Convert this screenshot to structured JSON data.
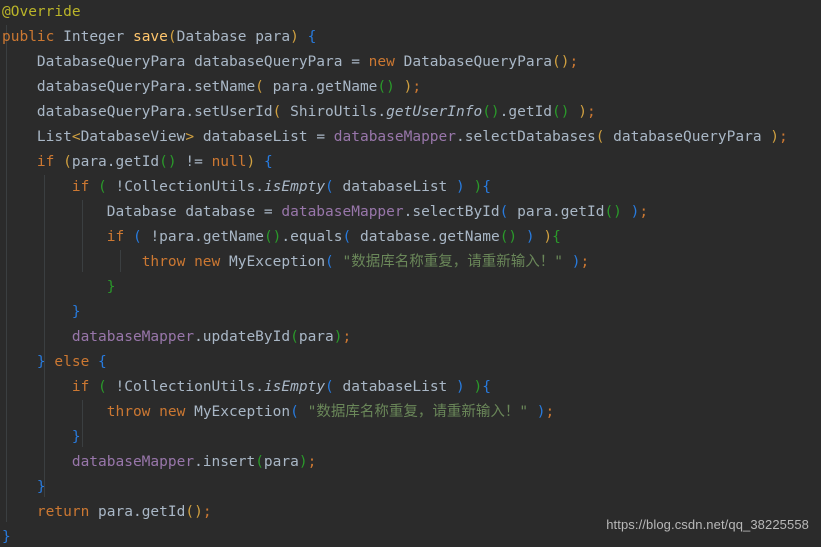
{
  "editor": {
    "background_color": "#2b2b2b",
    "default_text_color": "#a9b7c6",
    "language": "Java",
    "theme": "Darcula"
  },
  "colors": {
    "keyword": "#cc7832",
    "annotation": "#bbb529",
    "method_declaration": "#ffc66d",
    "field": "#9876aa",
    "string": "#6a8759",
    "identifier": "#a9b7c6",
    "paren_level1": "#d0a040",
    "paren_level2": "#287bde",
    "paren_level3": "#2a9a2a",
    "indent_guide": "#3b3f41"
  },
  "code": {
    "lines": [
      "@Override",
      "public Integer save(Database para) {",
      "    DatabaseQueryPara databaseQueryPara = new DatabaseQueryPara();",
      "    databaseQueryPara.setName( para.getName() );",
      "    databaseQueryPara.setUserId( ShiroUtils.getUserInfo().getId() );",
      "    List<DatabaseView> databaseList = databaseMapper.selectDatabases( databaseQueryPara );",
      "    if (para.getId() != null) {",
      "        if ( !CollectionUtils.isEmpty( databaseList ) ){",
      "            Database database = databaseMapper.selectById( para.getId() );",
      "            if ( !para.getName().equals( database.getName() ) ){",
      "                throw new MyException( \"数据库名称重复，请重新输入！\" );",
      "            }",
      "        }",
      "        databaseMapper.updateById(para);",
      "    } else {",
      "        if ( !CollectionUtils.isEmpty( databaseList ) ){",
      "            throw new MyException( \"数据库名称重复，请重新输入！\" );",
      "        }",
      "        databaseMapper.insert(para);",
      "    }",
      "    return para.getId();",
      "}"
    ],
    "strings": {
      "duplicate_name_message": "数据库名称重复，请重新输入！"
    },
    "identifiers": {
      "annotation": "@Override",
      "method_name": "save",
      "return_type": "Integer",
      "parameter_type": "Database",
      "parameter_name": "para",
      "query_para_type": "DatabaseQueryPara",
      "query_para_var": "databaseQueryPara",
      "list_type": "List",
      "list_generic": "DatabaseView",
      "list_var": "databaseList",
      "mapper_field": "databaseMapper",
      "exception_type": "MyException",
      "utils_shiro": "ShiroUtils",
      "utils_collection": "CollectionUtils",
      "entity_var": "database"
    }
  },
  "watermark": {
    "text": "https://blog.csdn.net/qq_38225558"
  }
}
